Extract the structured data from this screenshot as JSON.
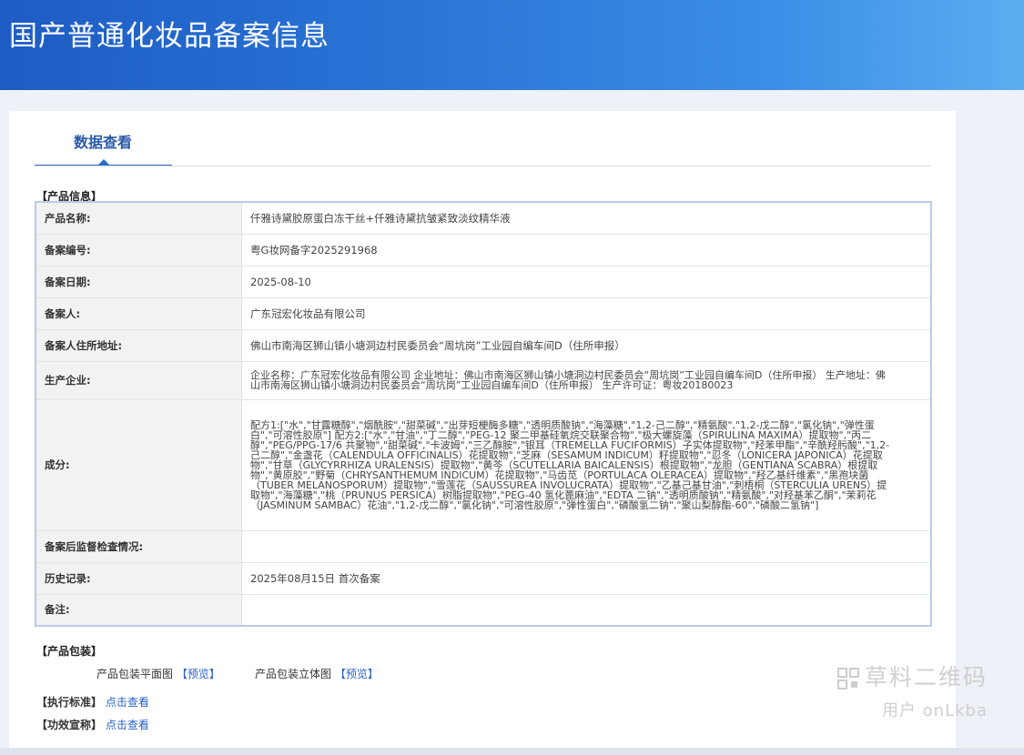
{
  "page": {
    "title": "国产普通化妆品备案信息"
  },
  "tabs": [
    {
      "label": "数据查看"
    }
  ],
  "product_section": {
    "heading": "【产品信息】"
  },
  "rows": {
    "name": {
      "label": "产品名称:",
      "value": "仟雅诗黛胶原蛋白冻干丝+仟雅诗黛抗皱紧致淡纹精华液"
    },
    "reg_no": {
      "label": "备案编号:",
      "value": "粤G妆网备字2025291968"
    },
    "reg_date": {
      "label": "备案日期:",
      "value": "2025-08-10"
    },
    "registrant": {
      "label": "备案人:",
      "value": "广东冠宏化妆品有限公司"
    },
    "address": {
      "label": "备案人住所地址:",
      "value": "佛山市南海区狮山镇小塘洞边村民委员会“周坑岗”工业园自编车间D（住所申报）"
    },
    "manufacturer": {
      "label": "生产企业:",
      "value": "企业名称：广东冠宏化妆品有限公司 企业地址：佛山市南海区狮山镇小塘洞边村民委员会“周坑岗”工业园自编车间D（住所申报） 生产地址：佛山市南海区狮山镇小塘洞边村民委员会“周坑岗”工业园自编车间D（住所申报） 生产许可证：粤妆20180023"
    },
    "ingredients": {
      "label": "成分:",
      "value": "配方1:[\"水\",\"甘露糖醇\",\"烟酰胺\",\"甜菜碱\",\"出芽短梗酶多糖\",\"透明质酸钠\",\"海藻糖\",\"1,2-己二醇\",\"精氨酸\",\"1,2-戊二醇\",\"氯化钠\",\"弹性蛋白\",\"可溶性胶原\"] 配方2:[\"水\",\"甘油\",\"丁二醇\",\"PEG-12 聚二甲基硅氧烷交联聚合物\",\"极大螺旋藻（SPIRULINA MAXIMA）提取物\",\"丙二醇\",\"PEG/PPG-17/6 共聚物\",\"甜菜碱\",\"卡波姆\",\"三乙醇胺\",\"银耳（TREMELLA FUCIFORMIS）子实体提取物\",\"羟苯甲酯\",\"辛酰羟肟酸\",\"1,2-己二醇\",\"金盏花（CALENDULA OFFICINALIS）花提取物\",\"芝麻（SESAMUM INDICUM）籽提取物\",\"忍冬（LONICERA JAPONICA）花提取物\",\"甘草（GLYCYRRHIZA URALENSIS）提取物\",\"黄芩（SCUTELLARIA BAICALENSIS）根提取物\",\"龙胆（GENTIANA SCABRA）根提取物\",\"黄原胶\",\"野菊（CHRYSANTHEMUM INDICUM）花提取物\",\"马齿苋（PORTULACA OLERACEA）提取物\",\"羟乙基纤维素\",\"黑孢块菌（TUBER MELANOSPORUM）提取物\",\"雪莲花（SAUSSUREA INVOLUCRATA）提取物\",\"乙基己基甘油\",\"刺梧桐（STERCULIA URENS）提取物\",\"海藻糖\",\"桃（PRUNUS PERSICA）树脂提取物\",\"PEG-40 氢化蓖麻油\",\"EDTA 二钠\",\"透明质酸钠\",\"精氨酸\",\"对羟基苯乙酮\",\"茉莉花（JASMINUM SAMBAC）花油\",\"1,2-戊二醇\",\"氯化钠\",\"可溶性胶原\",\"弹性蛋白\",\"磷酸氢二钠\",\"聚山梨醇酯-60\",\"磷酸二氢钠\"]"
    },
    "supervision": {
      "label": "备案后监督检查情况:",
      "value": ""
    },
    "history": {
      "label": "历史记录:",
      "value": "2025年08月15日 首次备案"
    },
    "remarks": {
      "label": "备注:",
      "value": ""
    }
  },
  "packaging": {
    "heading": "【产品包装】",
    "flat_label": "产品包装平面图",
    "flat_link": "【预览】",
    "solid_label": "产品包装立体图",
    "solid_link": "【预览】"
  },
  "standard": {
    "label": "【执行标准】",
    "link": "点击查看"
  },
  "efficacy": {
    "label": "【功效宣称】",
    "link": "点击查看"
  },
  "watermark": {
    "line1": "草料二维码",
    "line2": "用户 onLkba"
  }
}
